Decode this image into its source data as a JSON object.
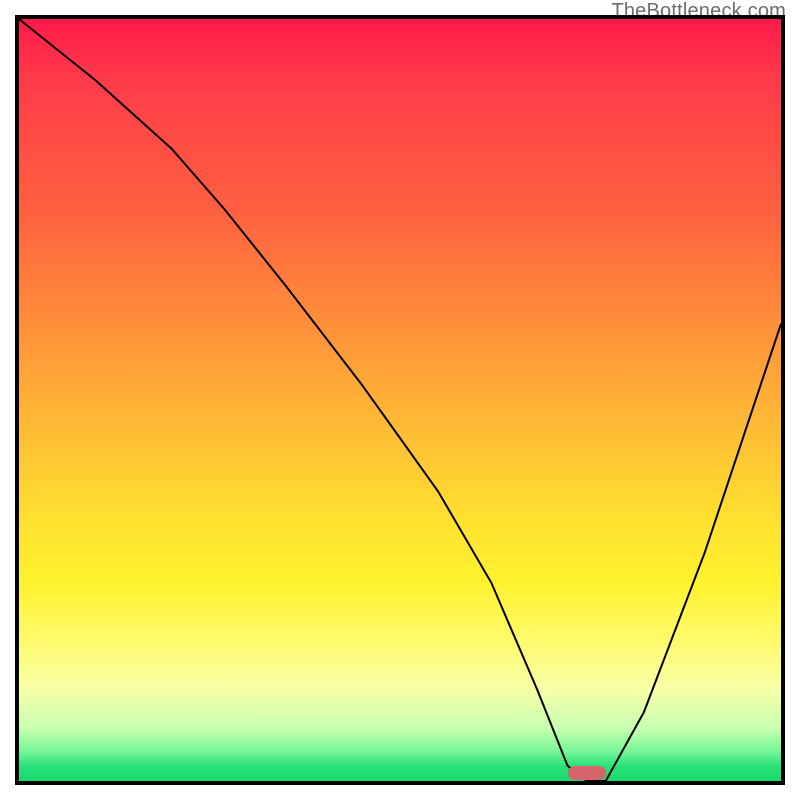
{
  "watermark": "TheBottleneck.com",
  "marker": {
    "x_pct": 74.5,
    "y_pct": 99.0,
    "color": "#d6646c"
  },
  "chart_data": {
    "type": "line",
    "title": "",
    "xlabel": "",
    "ylabel": "",
    "xlim": [
      0,
      100
    ],
    "ylim": [
      0,
      100
    ],
    "grid": false,
    "legend": false,
    "series": [
      {
        "name": "bottleneck-curve",
        "x": [
          0,
          10,
          20,
          27,
          35,
          45,
          55,
          62,
          68,
          72,
          74.5,
          77,
          82,
          90,
          100
        ],
        "y": [
          100,
          92,
          83,
          75,
          65,
          52,
          38,
          26,
          12,
          2,
          0,
          0,
          9,
          30,
          60
        ]
      }
    ],
    "note": "y is plotted downward from top (0 at bottom, 100 at top). Values estimated from pixel positions; chart has no visible tick labels."
  }
}
